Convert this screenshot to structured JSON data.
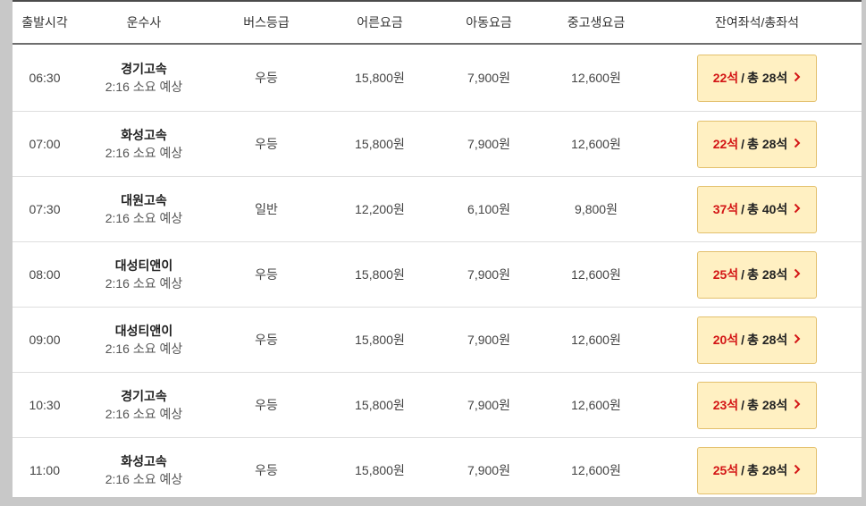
{
  "headers": {
    "depart": "출발시각",
    "company": "운수사",
    "grade": "버스등급",
    "adult": "어른요금",
    "child": "아동요금",
    "student": "중고생요금",
    "seats": "잔여좌석/총좌석"
  },
  "rows": [
    {
      "time": "06:30",
      "company": "경기고속",
      "duration": "2:16 소요 예상",
      "grade": "우등",
      "adult": "15,800원",
      "child": "7,900원",
      "student": "12,600원",
      "remain": "22석",
      "total": "총 28석"
    },
    {
      "time": "07:00",
      "company": "화성고속",
      "duration": "2:16 소요 예상",
      "grade": "우등",
      "adult": "15,800원",
      "child": "7,900원",
      "student": "12,600원",
      "remain": "22석",
      "total": "총 28석"
    },
    {
      "time": "07:30",
      "company": "대원고속",
      "duration": "2:16 소요 예상",
      "grade": "일반",
      "adult": "12,200원",
      "child": "6,100원",
      "student": "9,800원",
      "remain": "37석",
      "total": "총 40석"
    },
    {
      "time": "08:00",
      "company": "대성티앤이",
      "duration": "2:16 소요 예상",
      "grade": "우등",
      "adult": "15,800원",
      "child": "7,900원",
      "student": "12,600원",
      "remain": "25석",
      "total": "총 28석"
    },
    {
      "time": "09:00",
      "company": "대성티앤이",
      "duration": "2:16 소요 예상",
      "grade": "우등",
      "adult": "15,800원",
      "child": "7,900원",
      "student": "12,600원",
      "remain": "20석",
      "total": "총 28석"
    },
    {
      "time": "10:30",
      "company": "경기고속",
      "duration": "2:16 소요 예상",
      "grade": "우등",
      "adult": "15,800원",
      "child": "7,900원",
      "student": "12,600원",
      "remain": "23석",
      "total": "총 28석"
    },
    {
      "time": "11:00",
      "company": "화성고속",
      "duration": "2:16 소요 예상",
      "grade": "우등",
      "adult": "15,800원",
      "child": "7,900원",
      "student": "12,600원",
      "remain": "25석",
      "total": "총 28석"
    }
  ],
  "seat_separator": "/",
  "chevron_icon": "chevron-right-icon",
  "colors": {
    "remain": "#d31515",
    "button_bg": "#fff0c2",
    "button_border": "#e3c06d"
  }
}
